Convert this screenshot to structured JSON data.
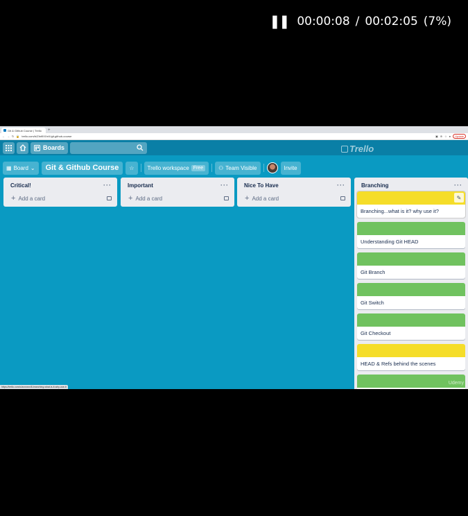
{
  "player": {
    "elapsed": "00:00:08",
    "separator": "/",
    "duration": "00:02:05",
    "percent": "(7%)"
  },
  "browser": {
    "tab_title": "Git & Github Course | Trello",
    "new_tab": "+",
    "url": "trello.com/b/ZInt9XXeX/git-github-course",
    "update_label": "Update"
  },
  "header": {
    "boards_label": "Boards",
    "logo_text": "Trello"
  },
  "board": {
    "view_label": "Board",
    "title": "Git & Github Course",
    "workspace_label": "Trello workspace",
    "workspace_badge": "Free",
    "visibility_label": "Team Visible",
    "invite_label": "Invite"
  },
  "lists": [
    {
      "title": "Critical!",
      "add_card": "Add a card"
    },
    {
      "title": "Important",
      "add_card": "Add a card"
    },
    {
      "title": "Nice To Have",
      "add_card": "Add a card"
    }
  ],
  "branching": {
    "title": "Branching",
    "cards": [
      {
        "title": "Branching...what is it? why use it?",
        "label_color": "#f5dd29"
      },
      {
        "title": "Understanding Git HEAD",
        "label_color": "#70c25f"
      },
      {
        "title": "Git Branch",
        "label_color": "#70c25f"
      },
      {
        "title": "Git Switch",
        "label_color": "#70c25f"
      },
      {
        "title": "Git Checkout",
        "label_color": "#70c25f"
      },
      {
        "title": "HEAD & Refs behind the scenes",
        "label_color": "#f5dd29"
      },
      {
        "title": "",
        "label_color": "#70c25f"
      }
    ]
  },
  "status_url": "https://trello.com/c/axxxxxx/8-branching-what-is-it-why-use-it",
  "watermark": "Udemy",
  "colors": {
    "board_bg": "#0a9ac2",
    "list_bg": "#ebecf0",
    "yellow_label": "#f5dd29",
    "green_label": "#70c25f"
  }
}
